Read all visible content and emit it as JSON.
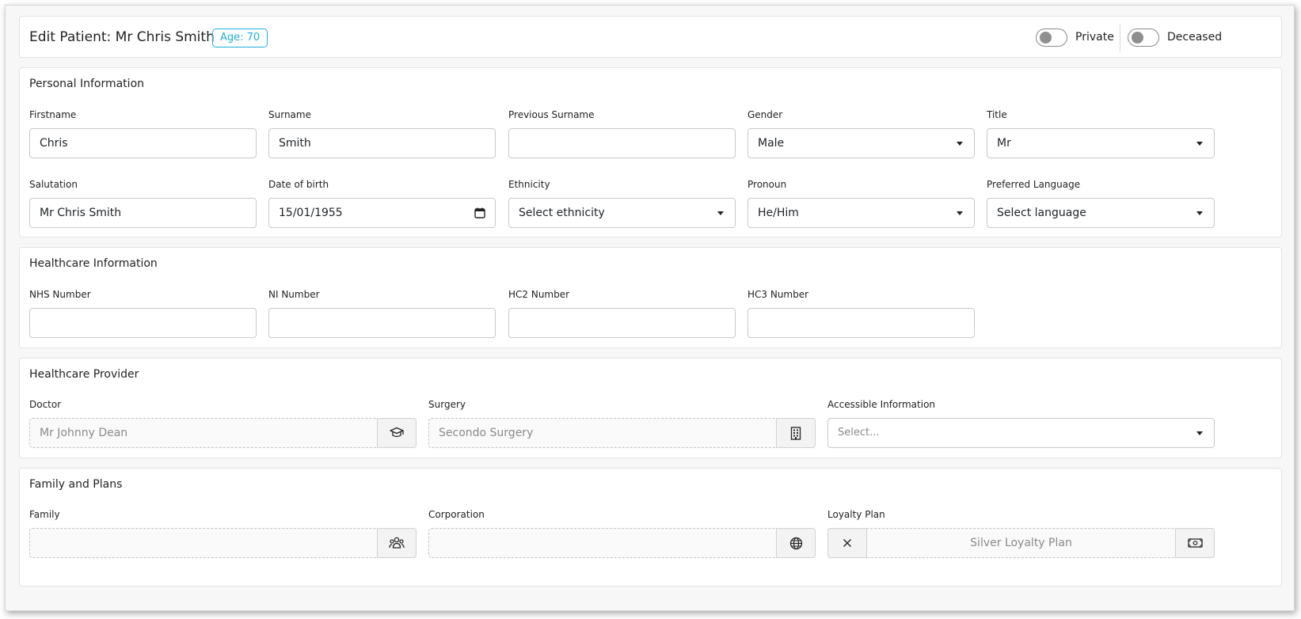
{
  "header": {
    "title": "Edit Patient: Mr Chris Smith",
    "age_badge": "Age: 70",
    "private_label": "Private",
    "private_on": false,
    "deceased_label": "Deceased",
    "deceased_on": false
  },
  "personal": {
    "title": "Personal Information",
    "firstname": {
      "label": "Firstname",
      "value": "Chris"
    },
    "surname": {
      "label": "Surname",
      "value": "Smith"
    },
    "previous_surname": {
      "label": "Previous Surname",
      "value": ""
    },
    "gender": {
      "label": "Gender",
      "value": "Male"
    },
    "title_field": {
      "label": "Title",
      "value": "Mr"
    },
    "salutation": {
      "label": "Salutation",
      "value": "Mr Chris Smith"
    },
    "dob": {
      "label": "Date of birth",
      "value": "15/01/1955"
    },
    "ethnicity": {
      "label": "Ethnicity",
      "value": "Select ethnicity"
    },
    "pronoun": {
      "label": "Pronoun",
      "value": "He/Him"
    },
    "language": {
      "label": "Preferred Language",
      "value": "Select language"
    }
  },
  "healthcare": {
    "title": "Healthcare Information",
    "nhs": {
      "label": "NHS Number",
      "value": ""
    },
    "ni": {
      "label": "NI Number",
      "value": ""
    },
    "hc2": {
      "label": "HC2 Number",
      "value": ""
    },
    "hc3": {
      "label": "HC3 Number",
      "value": ""
    }
  },
  "provider": {
    "title": "Healthcare Provider",
    "doctor": {
      "label": "Doctor",
      "value": "Mr Johnny Dean",
      "icon": "graduation-cap-icon"
    },
    "surgery": {
      "label": "Surgery",
      "value": "Secondo Surgery",
      "icon": "building-icon"
    },
    "accessible": {
      "label": "Accessible Information",
      "placeholder": "Select..."
    }
  },
  "family": {
    "title": "Family and Plans",
    "family": {
      "label": "Family",
      "value": "",
      "icon": "people-icon"
    },
    "corporation": {
      "label": "Corporation",
      "value": "",
      "icon": "globe-icon"
    },
    "loyalty": {
      "label": "Loyalty Plan",
      "value": "Silver Loyalty Plan",
      "clear_icon": "close-icon",
      "icon": "cash-icon"
    }
  },
  "colors": {
    "accent": "#1eaedb",
    "border": "#c9c9c9",
    "background": "#f7f7f7"
  }
}
